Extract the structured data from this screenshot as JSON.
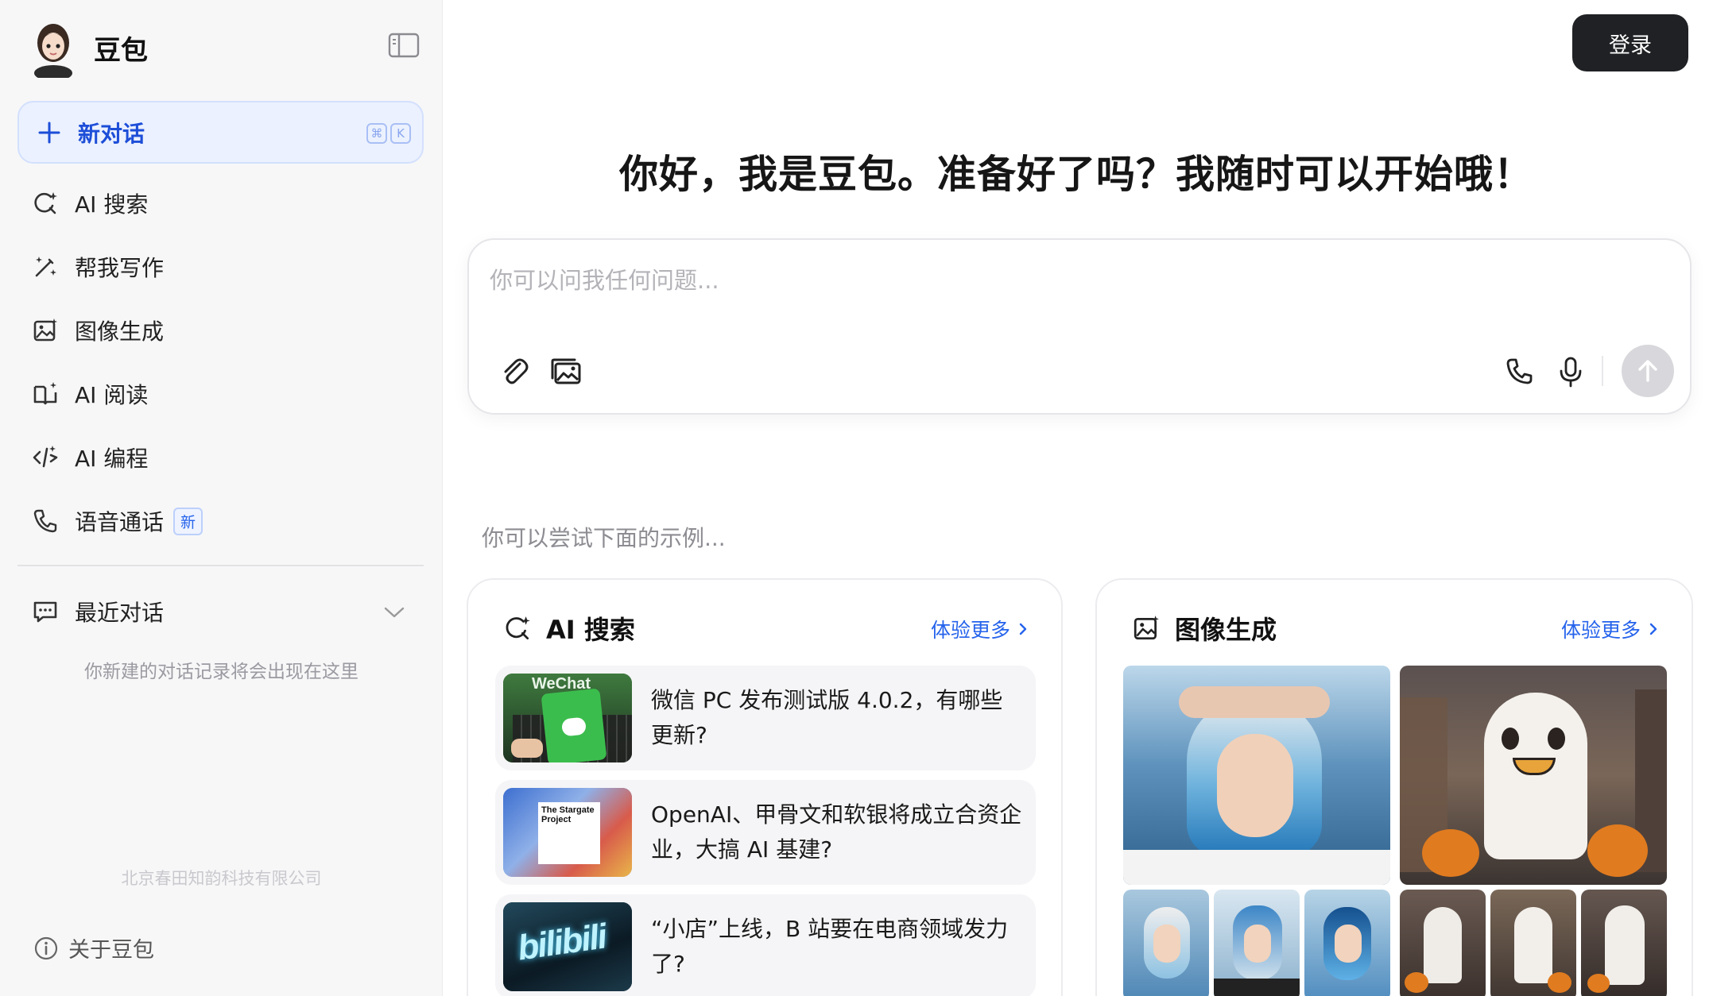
{
  "brand": {
    "name": "豆包"
  },
  "sidebar": {
    "new_chat": {
      "label": "新对话",
      "shortcut": [
        "⌘",
        "K"
      ]
    },
    "items": [
      {
        "label": "AI 搜索",
        "icon": "ai-search-icon"
      },
      {
        "label": "帮我写作",
        "icon": "magic-pen-icon"
      },
      {
        "label": "图像生成",
        "icon": "image-generate-icon"
      },
      {
        "label": "AI 阅读",
        "icon": "book-reading-icon"
      },
      {
        "label": "AI 编程",
        "icon": "code-icon"
      },
      {
        "label": "语音通话",
        "icon": "phone-icon",
        "badge": "新"
      }
    ],
    "recent": {
      "label": "最近对话",
      "empty_hint": "你新建的对话记录将会出现在这里"
    },
    "company": "北京春田知韵科技有限公司",
    "about": "关于豆包"
  },
  "header": {
    "login_label": "登录"
  },
  "main": {
    "greeting": "你好，我是豆包。准备好了吗？我随时可以开始哦！",
    "input": {
      "placeholder": "你可以问我任何问题..."
    },
    "examples_hint": "你可以尝试下面的示例..."
  },
  "cards": {
    "search": {
      "title": "AI 搜索",
      "more": "体验更多",
      "items": [
        {
          "text": "微信 PC 发布测试版 4.0.2，有哪些更新?",
          "thumb_label": "WeChat"
        },
        {
          "text": "OpenAI、甲骨文和软银将成立合资企业，大搞 AI 基建?",
          "thumb_label": "The Stargate Project"
        },
        {
          "text": "“小店”上线，B 站要在电商领域发力了?",
          "thumb_label": "bilibili"
        }
      ]
    },
    "image": {
      "title": "图像生成",
      "more": "体验更多"
    }
  },
  "colors": {
    "accent": "#2563eb",
    "login_bg": "#1f2124",
    "new_chat_bg": "#ebf1fe"
  }
}
